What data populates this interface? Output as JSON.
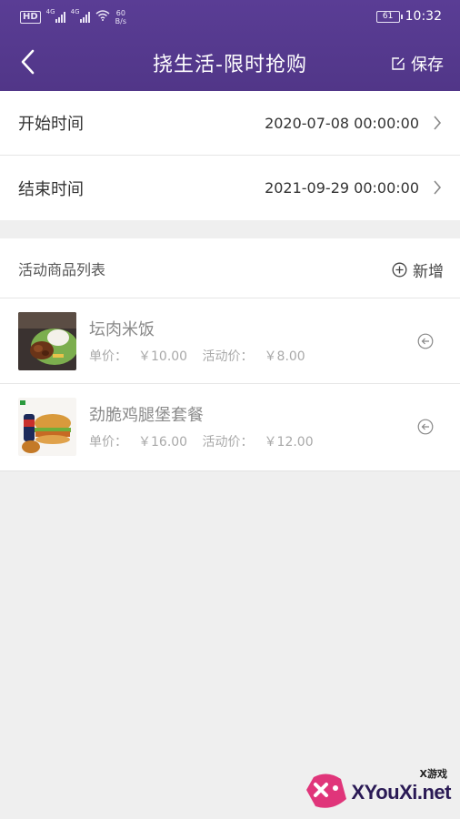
{
  "status_bar": {
    "hd": "HD",
    "sim1_type": "4G",
    "sim2_type": "4G",
    "speed_value": "60",
    "speed_unit": "B/s",
    "battery_level": "61",
    "time": "10:32"
  },
  "nav": {
    "title": "挠生活-限时抢购",
    "save_label": "保存"
  },
  "time_settings": [
    {
      "label": "开始时间",
      "value": "2020-07-08 00:00:00"
    },
    {
      "label": "结束时间",
      "value": "2021-09-29 00:00:00"
    }
  ],
  "product_list": {
    "title": "活动商品列表",
    "add_label": "新增",
    "items": [
      {
        "name": "坛肉米饭",
        "unit_price_label": "单价：",
        "unit_price": "￥10.00",
        "activity_price_label": "活动价：",
        "activity_price": "￥8.00"
      },
      {
        "name": "劲脆鸡腿堡套餐",
        "unit_price_label": "单价：",
        "unit_price": "￥16.00",
        "activity_price_label": "活动价：",
        "activity_price": "￥12.00"
      }
    ]
  },
  "watermark": {
    "small": "X游戏",
    "text": "XYouXi.net"
  },
  "colors": {
    "header": "#533889",
    "background": "#efefef"
  }
}
